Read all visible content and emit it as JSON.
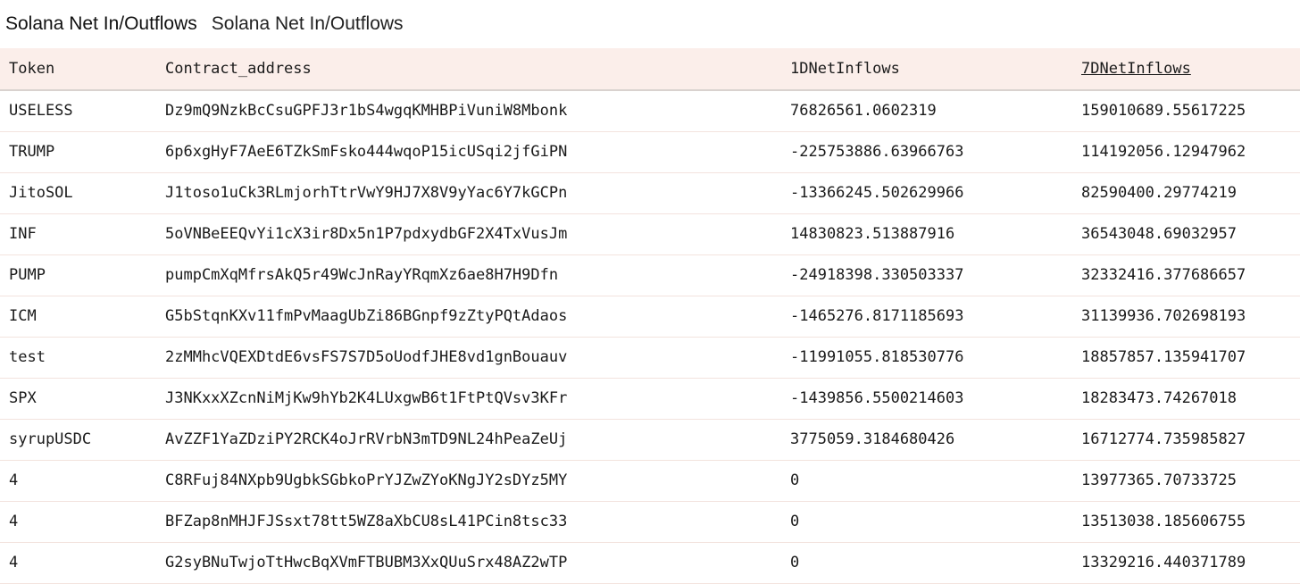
{
  "header": {
    "title": "Solana Net In/Outflows",
    "subtitle": "Solana Net In/Outflows"
  },
  "table": {
    "columns": [
      "Token",
      "Contract_address",
      "1DNetInflows",
      "7DNetInflows"
    ],
    "sorted_column": "7DNetInflows",
    "rows": [
      [
        "USELESS",
        "Dz9mQ9NzkBcCsuGPFJ3r1bS4wgqKMHBPiVuniW8Mbonk",
        "76826561.0602319",
        "159010689.55617225"
      ],
      [
        "TRUMP",
        "6p6xgHyF7AeE6TZkSmFsko444wqoP15icUSqi2jfGiPN",
        "-225753886.63966763",
        "114192056.12947962"
      ],
      [
        "JitoSOL",
        "J1toso1uCk3RLmjorhTtrVwY9HJ7X8V9yYac6Y7kGCPn",
        "-13366245.502629966",
        "82590400.29774219"
      ],
      [
        "INF",
        "5oVNBeEEQvYi1cX3ir8Dx5n1P7pdxydbGF2X4TxVusJm",
        "14830823.513887916",
        "36543048.69032957"
      ],
      [
        "PUMP",
        "pumpCmXqMfrsAkQ5r49WcJnRayYRqmXz6ae8H7H9Dfn",
        "-24918398.330503337",
        "32332416.377686657"
      ],
      [
        "ICM",
        "G5bStqnKXv11fmPvMaagUbZi86BGnpf9zZtyPQtAdaos",
        "-1465276.8171185693",
        "31139936.702698193"
      ],
      [
        "test",
        "2zMMhcVQEXDtdE6vsFS7S7D5oUodfJHE8vd1gnBouauv",
        "-11991055.818530776",
        "18857857.135941707"
      ],
      [
        "SPX",
        "J3NKxxXZcnNiMjKw9hYb2K4LUxgwB6t1FtPtQVsv3KFr",
        "-1439856.5500214603",
        "18283473.74267018"
      ],
      [
        "syrupUSDC",
        "AvZZF1YaZDziPY2RCK4oJrRVrbN3mTD9NL24hPeaZeUj",
        "3775059.3184680426",
        "16712774.735985827"
      ],
      [
        "4",
        "C8RFuj84NXpb9UgbkSGbkoPrYJZwZYoKNgJY2sDYz5MY",
        "0",
        "13977365.70733725"
      ],
      [
        "4",
        "BFZap8nMHJFJSsxt78tt5WZ8aXbCU8sL41PCin8tsc33",
        "0",
        "13513038.185606755"
      ],
      [
        "4",
        "G2syBNuTwjoTtHwcBqXVmFTBUBM3XxQUuSrx48AZ2wTP",
        "0",
        "13329216.440371789"
      ]
    ]
  }
}
